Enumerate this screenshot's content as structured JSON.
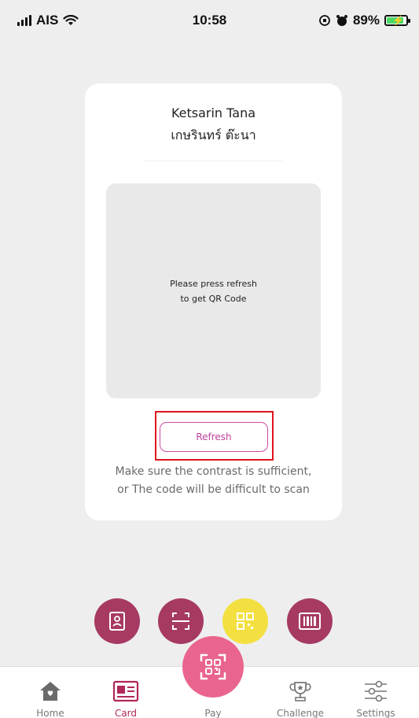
{
  "status_bar": {
    "carrier": "AIS",
    "time": "10:58",
    "battery": "89%",
    "battery_level": 0.89
  },
  "card": {
    "name_en": "Ketsarin Tana",
    "name_th": "เกษรินทร์ ต๊ะนา",
    "qr_placeholder_line1": "Please press refresh",
    "qr_placeholder_line2": "to get QR Code",
    "refresh_label": "Refresh",
    "hint_line1": "Make sure the contrast is sufficient,",
    "hint_line2": "or The code will be difficult to scan"
  },
  "fab_row": [
    {
      "name": "id-card-mode-button",
      "icon": "id-card-icon",
      "color": "#a63a63"
    },
    {
      "name": "scan-mode-button",
      "icon": "scan-icon",
      "color": "#a63a63"
    },
    {
      "name": "qr-mode-button",
      "icon": "qr-code-icon",
      "color": "#f3e040"
    },
    {
      "name": "barcode-mode-button",
      "icon": "barcode-icon",
      "color": "#a63a63"
    }
  ],
  "bottom_nav": {
    "home": "Home",
    "card": "Card",
    "pay": "Pay",
    "challenge": "Challenge",
    "settings": "Settings",
    "active": "card"
  },
  "colors": {
    "accent": "#b0285a",
    "maroon": "#a63a63",
    "pink": "#e9658d",
    "yellow": "#f3e040",
    "highlight": "#e0121c"
  }
}
